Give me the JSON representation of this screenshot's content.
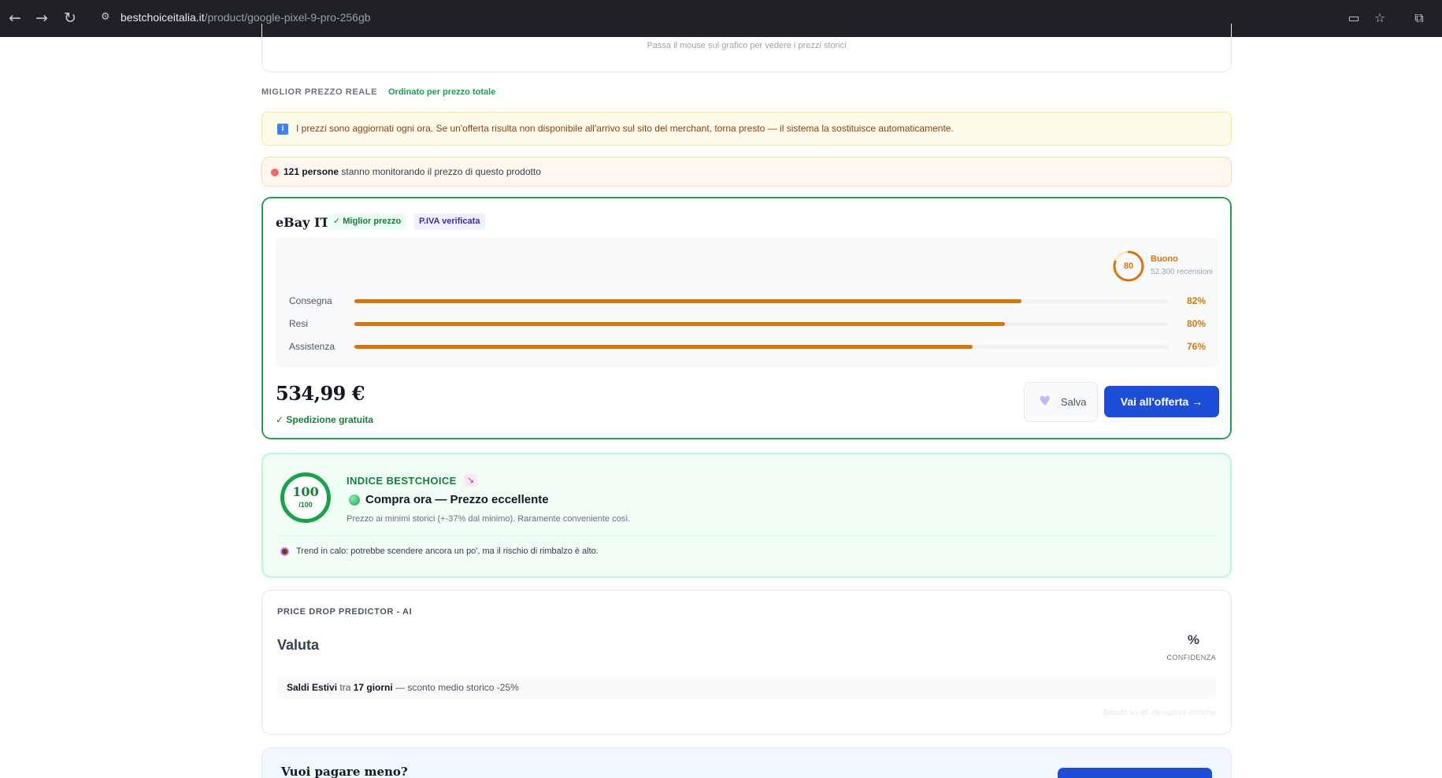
{
  "browser": {
    "url_host": "bestchoiceitalia.it",
    "url_path": "/product/google-pixel-9-pro-256gb"
  },
  "chart_hint": "Passa il mouse sul grafico per vedere i prezzi storici",
  "section": {
    "label": "MIGLIOR PREZZO REALE",
    "sort": "Ordinato per prezzo totale"
  },
  "notice_info": "I prezzi sono aggiornati ogni ora. Se un'offerta risulta non disponibile all'arrivo sul sito del merchant, torna presto — il sistema la sostituisce automaticamente.",
  "watchers": {
    "count": "121 persone",
    "text": " stanno monitorando il prezzo di questo prodotto"
  },
  "offer": {
    "merchant": "eBay IT",
    "badge_best": "✓ Miglior prezzo",
    "badge_piva": "P.IVA verificata",
    "rating_score": "80",
    "rating_score_value": 80,
    "rating_label": "Buono",
    "rating_count": "52.300 recensioni",
    "metrics": [
      {
        "label": "Consegna",
        "pct": "82%",
        "value": 0.82
      },
      {
        "label": "Resi",
        "pct": "80%",
        "value": 0.8
      },
      {
        "label": "Assistenza",
        "pct": "76%",
        "value": 0.76
      }
    ],
    "price": "534,99 €",
    "shipping": "✓ Spedizione gratuita",
    "save_label": "Salva",
    "cta_label": "Vai all'offerta →"
  },
  "index": {
    "score": "100",
    "score_max": "/100",
    "title": "INDICE BESTCHOICE",
    "verdict": "Compra ora — Prezzo eccellente",
    "description": "Prezzo ai minimi storici (+-37% dal minimo). Raramente conveniente così.",
    "trend": "Trend in calo: potrebbe scendere ancora un po', ma il rischio di rimbalzo è alto."
  },
  "predictor": {
    "title": "PRICE DROP PREDICTOR - AI",
    "headline": "Valuta",
    "confidence_value": "%",
    "confidence_label": "CONFIDENZA",
    "event_name": "Saldi Estivi",
    "event_mid": " tra ",
    "event_when": "17 giorni",
    "event_tail": " — sconto medio storico -25%",
    "footnote": "Basato su 90 rilevazioni storiche"
  },
  "bottom": {
    "title": "Vuoi pagare meno?"
  },
  "colors": {
    "accent": "#1d4ed8",
    "success": "#16a34a",
    "rating": "#d97706"
  }
}
